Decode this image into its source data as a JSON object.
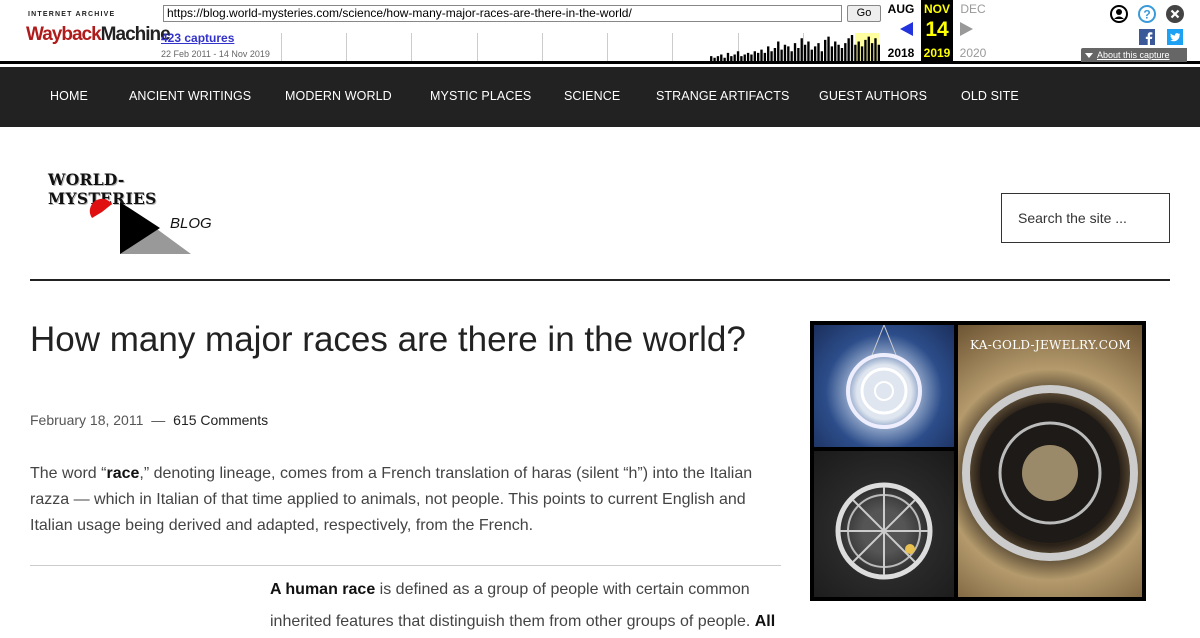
{
  "wayback": {
    "logo_line1": "INTERNET ARCHIVE",
    "logo_wayback": "Wayback",
    "logo_machine": "Machine",
    "url": "https://blog.world-mysteries.com/science/how-many-major-races-are-there-in-the-world/",
    "go_label": "Go",
    "captures": "423 captures",
    "range": "22 Feb 2011 - 14 Nov 2019",
    "prev_month": "AUG",
    "cur_month": "NOV",
    "next_month": "DEC",
    "cur_day": "14",
    "prev_year": "2018",
    "cur_year": "2019",
    "next_year": "2020",
    "about_label": "About this capture",
    "sparkline": [
      0,
      0,
      0,
      0,
      0,
      0,
      0,
      0,
      0,
      0,
      0,
      0,
      0,
      0,
      0,
      0,
      0,
      0,
      0,
      0,
      0,
      0,
      0,
      0,
      0,
      0,
      0,
      0,
      0,
      0,
      0,
      0,
      0,
      0,
      0,
      0,
      0,
      0,
      0,
      0,
      0,
      0,
      0,
      0,
      0,
      0,
      0,
      0,
      0,
      0,
      0,
      0,
      0,
      0,
      0,
      0,
      0,
      0,
      0,
      0,
      0,
      0,
      0,
      0,
      0,
      0,
      0,
      0,
      0,
      0,
      0,
      0,
      0,
      0,
      0,
      0,
      0,
      0,
      0,
      0,
      0,
      0,
      0,
      0,
      0,
      0,
      0,
      0,
      0,
      0,
      0,
      0,
      0,
      0,
      0,
      0,
      0,
      0,
      0,
      0,
      0,
      0,
      0,
      0,
      0,
      0,
      0,
      0,
      0,
      0,
      0,
      0,
      0,
      0,
      0,
      0,
      0,
      0,
      0,
      0,
      0,
      0,
      0,
      0,
      0,
      0,
      0,
      0,
      3,
      2,
      3,
      4,
      2,
      5,
      3,
      4,
      6,
      3,
      4,
      5,
      4,
      6,
      5,
      7,
      5,
      9,
      6,
      8,
      12,
      7,
      10,
      9,
      6,
      11,
      8,
      14,
      10,
      12,
      7,
      9,
      11,
      6,
      13,
      15,
      9,
      12,
      10,
      8,
      11,
      14,
      16,
      10,
      12,
      9,
      13,
      15,
      11,
      14,
      10
    ]
  },
  "nav": {
    "items": [
      "HOME",
      "ANCIENT WRITINGS",
      "MODERN WORLD",
      "MYSTIC PLACES",
      "SCIENCE",
      "STRANGE ARTIFACTS",
      "GUEST AUTHORS",
      "OLD SITE"
    ]
  },
  "header": {
    "logo_text": "WORLD-MYSTERIES",
    "logo_blog": "BLOG",
    "search_placeholder": "Search the site ..."
  },
  "article": {
    "title": "How many major races are there in the world?",
    "date": "February 18, 2011",
    "separator": "—",
    "comments": "615 Comments",
    "para1_pre": "The word “",
    "para1_bold": "race",
    "para1_post": ",” denoting lineage, comes from a French translation of haras (silent “h”) into the Italian razza — which in Italian of that time applied to animals, not people. This points to current English and Italian usage being derived and adapted, respectively, from the French.",
    "para2_bold": "A human race",
    "para2_text": " is defined as a group of people with certain common inherited features that distinguish them from other groups of people. ",
    "para2_bold2": "All"
  },
  "ad": {
    "brand": "KA-GOLD-JEWELRY.COM"
  },
  "colors": {
    "nav_bg": "#222222",
    "wayback_link": "#3333cc",
    "calendar_highlight": "#ffff00"
  }
}
